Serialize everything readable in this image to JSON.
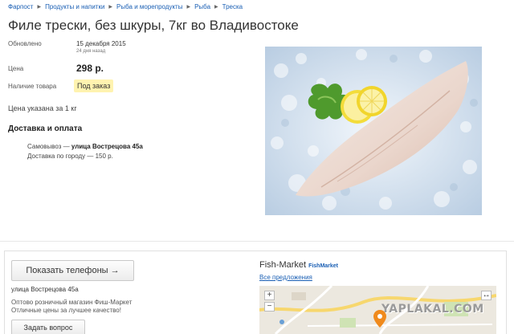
{
  "breadcrumb": [
    "Фарпост",
    "Продукты и напитки",
    "Рыба и морепродукты",
    "Рыба",
    "Треска"
  ],
  "title": "Филе трески, без шкуры, 7кг во Владивостоке",
  "info": {
    "updated_label": "Обновлено",
    "updated_value": "15 декабря 2015",
    "updated_ago": "24 дня назад",
    "price_label": "Цена",
    "price_value": "298 р.",
    "availability_label": "Наличие товара",
    "availability_value": "Под заказ"
  },
  "price_note": "Цена указана за 1 кг",
  "delivery": {
    "heading": "Доставка и оплата",
    "pickup_prefix": "Самовывоз — ",
    "pickup_address": "улица Вострецова 45а",
    "city_delivery": "Доставка по городу — 150 р."
  },
  "photo": {
    "alt": "Фото: филе трески на льду с лимоном и салатом"
  },
  "seller": {
    "show_phones_button": "Показать телефоны →",
    "address": "улица Вострецова 45а",
    "description_line1": "Оптово розничный магазин Фиш-Маркет",
    "description_line2": "Отличные цены за лучшее качество!",
    "ask_button": "Задать вопрос",
    "store_name": "Fish-Market",
    "store_logo_text": "FishMarket",
    "all_offers_link": "Все предложения"
  },
  "map": {
    "zoom_in": "+",
    "zoom_out": "−",
    "expand": "↔"
  },
  "watermark": "YAPLAKAL.COM",
  "colors": {
    "link": "#1a5fb4",
    "badge_bg": "#fff3b0",
    "map_marker": "#f08a1c"
  }
}
